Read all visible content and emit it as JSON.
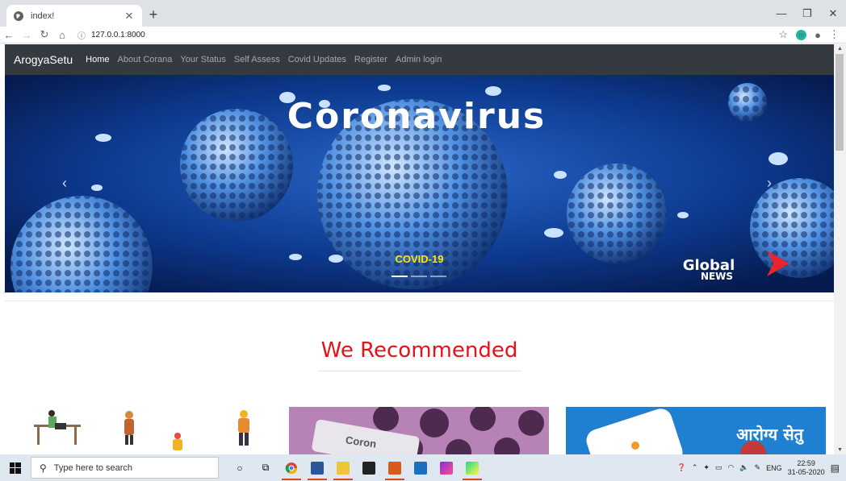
{
  "browser": {
    "tab_title": "index!",
    "url": "127.0.0.1:8000"
  },
  "navbar": {
    "brand": "ArogyaSetu",
    "links": [
      "Home",
      "About Corana",
      "Your Status",
      "Self Assess",
      "Covid Updates",
      "Register",
      "Admin login"
    ]
  },
  "carousel": {
    "headline": "Coronavirus",
    "caption": "COVID-19",
    "logo_top": "Global",
    "logo_bottom": "NEWS",
    "active_slide": 1,
    "slide_count": 3
  },
  "section": {
    "title": "We Recommended"
  },
  "cards": {
    "card2_text": "Coron",
    "card3_text": "आरोग्य सेतु"
  },
  "taskbar": {
    "search_placeholder": "Type here to search",
    "lang": "ENG",
    "time": "22:59",
    "date": "31-05-2020"
  },
  "colors": {
    "navbar_bg": "#343a40",
    "section_title": "#e8101a",
    "caption": "#ffe600"
  }
}
